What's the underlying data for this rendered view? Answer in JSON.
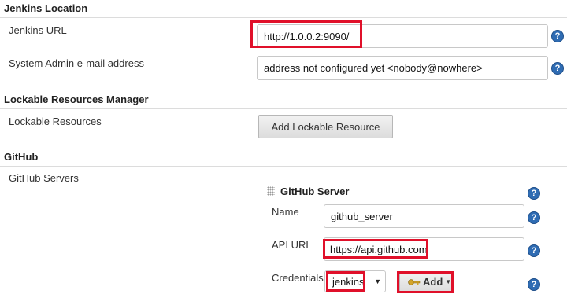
{
  "jenkins_location": {
    "title": "Jenkins Location",
    "url_label": "Jenkins URL",
    "url_value": "http://1.0.0.2:9090/",
    "email_label": "System Admin e-mail address",
    "email_value": "address not configured yet <nobody@nowhere>"
  },
  "lockable": {
    "title": "Lockable Resources Manager",
    "resources_label": "Lockable Resources",
    "add_button": "Add Lockable Resource"
  },
  "github": {
    "title": "GitHub",
    "servers_label": "GitHub Servers",
    "server": {
      "title": "GitHub Server",
      "name_label": "Name",
      "name_value": "github_server",
      "api_label": "API URL",
      "api_value": "https://api.github.com",
      "cred_label": "Credentials",
      "cred_value": "jenkins",
      "add_label": "Add"
    }
  },
  "help_glyph": "?",
  "colors": {
    "highlight": "#e0102a",
    "help": "#2f6cb3"
  }
}
